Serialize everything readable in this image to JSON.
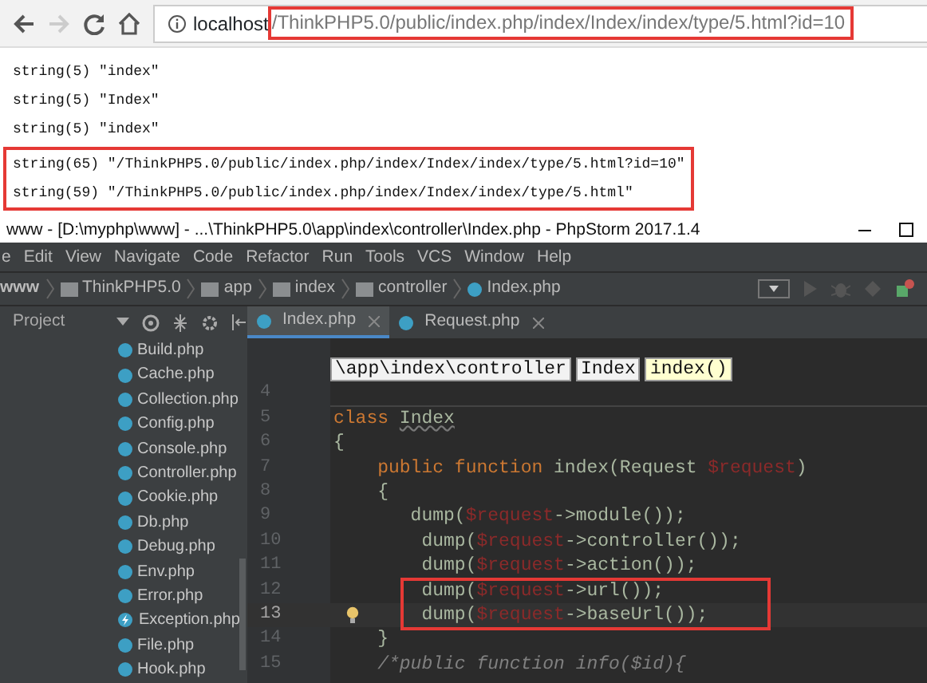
{
  "browser": {
    "address": {
      "host": "localhost",
      "path": "/ThinkPHP5.0/public/index.php/index/Index/index/type/5.html?id=10",
      "path_boxed": true
    }
  },
  "output": [
    {
      "boxed": false,
      "lines": [
        "string(5) \"index\"",
        "string(5) \"Index\"",
        "string(5) \"index\""
      ]
    },
    {
      "boxed": true,
      "lines": [
        "string(65) \"/ThinkPHP5.0/public/index.php/index/Index/index/type/5.html?id=10\"",
        "string(59) \"/ThinkPHP5.0/public/index.php/index/Index/index/type/5.html\""
      ]
    }
  ],
  "ide": {
    "title": "www - [D:\\myphp\\www] - ...\\ThinkPHP5.0\\app\\index\\controller\\Index.php - PhpStorm 2017.1.4",
    "menu": [
      "e",
      "Edit",
      "View",
      "Navigate",
      "Code",
      "Refactor",
      "Run",
      "Tools",
      "VCS",
      "Window",
      "Help"
    ],
    "breadcrumbs": [
      {
        "kind": "project",
        "label": "www"
      },
      {
        "kind": "folder",
        "label": "ThinkPHP5.0"
      },
      {
        "kind": "folder",
        "label": "app"
      },
      {
        "kind": "folder",
        "label": "index"
      },
      {
        "kind": "folder",
        "label": "controller"
      },
      {
        "kind": "class",
        "label": "Index.php"
      }
    ],
    "project_panel": {
      "title": "Project",
      "files": [
        {
          "kind": "class",
          "name": "Build.php"
        },
        {
          "kind": "class",
          "name": "Cache.php"
        },
        {
          "kind": "class",
          "name": "Collection.php"
        },
        {
          "kind": "class",
          "name": "Config.php"
        },
        {
          "kind": "class",
          "name": "Console.php"
        },
        {
          "kind": "class",
          "name": "Controller.php"
        },
        {
          "kind": "class",
          "name": "Cookie.php"
        },
        {
          "kind": "class",
          "name": "Db.php"
        },
        {
          "kind": "class",
          "name": "Debug.php"
        },
        {
          "kind": "class",
          "name": "Env.php"
        },
        {
          "kind": "class",
          "name": "Error.php"
        },
        {
          "kind": "exception",
          "name": "Exception.php"
        },
        {
          "kind": "class",
          "name": "File.php"
        },
        {
          "kind": "class",
          "name": "Hook.php"
        }
      ]
    },
    "tabs": [
      {
        "label": "Index.php",
        "selected": true
      },
      {
        "label": "Request.php",
        "selected": false
      }
    ],
    "editor": {
      "popup": [
        {
          "label": "\\app\\index\\controller",
          "selected": false
        },
        {
          "label": "Index",
          "selected": false
        },
        {
          "label": "index()",
          "selected": true
        }
      ],
      "lines": [
        {
          "number": "4",
          "current": false,
          "boxed": false,
          "bulb": false
        },
        {
          "number": "5",
          "current": false,
          "boxed": false,
          "bulb": false,
          "tokens": [
            {
              "kind": "keyword",
              "text": "class "
            },
            {
              "kind": "classname",
              "text": "Index"
            }
          ]
        },
        {
          "number": "6",
          "current": false,
          "boxed": false,
          "bulb": false,
          "tokens": [
            {
              "kind": "plain",
              "text": "{"
            }
          ]
        },
        {
          "number": "7",
          "current": false,
          "boxed": false,
          "bulb": false,
          "tokens": [
            {
              "kind": "keyword",
              "text": "    public function"
            },
            {
              "kind": "plain",
              "text": " index(Request "
            },
            {
              "kind": "var",
              "text": "$request"
            },
            {
              "kind": "plain",
              "text": ")"
            }
          ]
        },
        {
          "number": "8",
          "current": false,
          "boxed": false,
          "bulb": false,
          "tokens": [
            {
              "kind": "plain",
              "text": "    {"
            }
          ]
        },
        {
          "number": "9",
          "current": false,
          "boxed": false,
          "bulb": false,
          "tokens": [
            {
              "kind": "plain",
              "text": "       dump("
            },
            {
              "kind": "var",
              "text": "$request"
            },
            {
              "kind": "plain",
              "text": "->module());"
            }
          ]
        },
        {
          "number": "10",
          "current": false,
          "boxed": false,
          "bulb": false,
          "tokens": [
            {
              "kind": "plain",
              "text": "        dump("
            },
            {
              "kind": "var",
              "text": "$request"
            },
            {
              "kind": "plain",
              "text": "->controller());"
            }
          ]
        },
        {
          "number": "11",
          "current": false,
          "boxed": false,
          "bulb": false,
          "tokens": [
            {
              "kind": "plain",
              "text": "        dump("
            },
            {
              "kind": "var",
              "text": "$request"
            },
            {
              "kind": "plain",
              "text": "->action());"
            }
          ]
        },
        {
          "number": "12",
          "current": false,
          "boxed": true,
          "bulb": false,
          "tokens": [
            {
              "kind": "plain",
              "text": "        dump("
            },
            {
              "kind": "var",
              "text": "$request"
            },
            {
              "kind": "plain",
              "text": "->url());"
            }
          ]
        },
        {
          "number": "13",
          "current": true,
          "boxed": true,
          "bulb": true,
          "tokens": [
            {
              "kind": "plain",
              "text": "        dump("
            },
            {
              "kind": "var",
              "text": "$request"
            },
            {
              "kind": "plain",
              "text": "->baseUrl());"
            }
          ]
        },
        {
          "number": "14",
          "current": false,
          "boxed": false,
          "bulb": false,
          "tokens": [
            {
              "kind": "plain",
              "text": "    }"
            }
          ]
        },
        {
          "number": "15",
          "current": false,
          "boxed": false,
          "bulb": false,
          "tokens": [
            {
              "kind": "comment",
              "text": "    /*public function info($id){"
            }
          ]
        }
      ]
    }
  }
}
